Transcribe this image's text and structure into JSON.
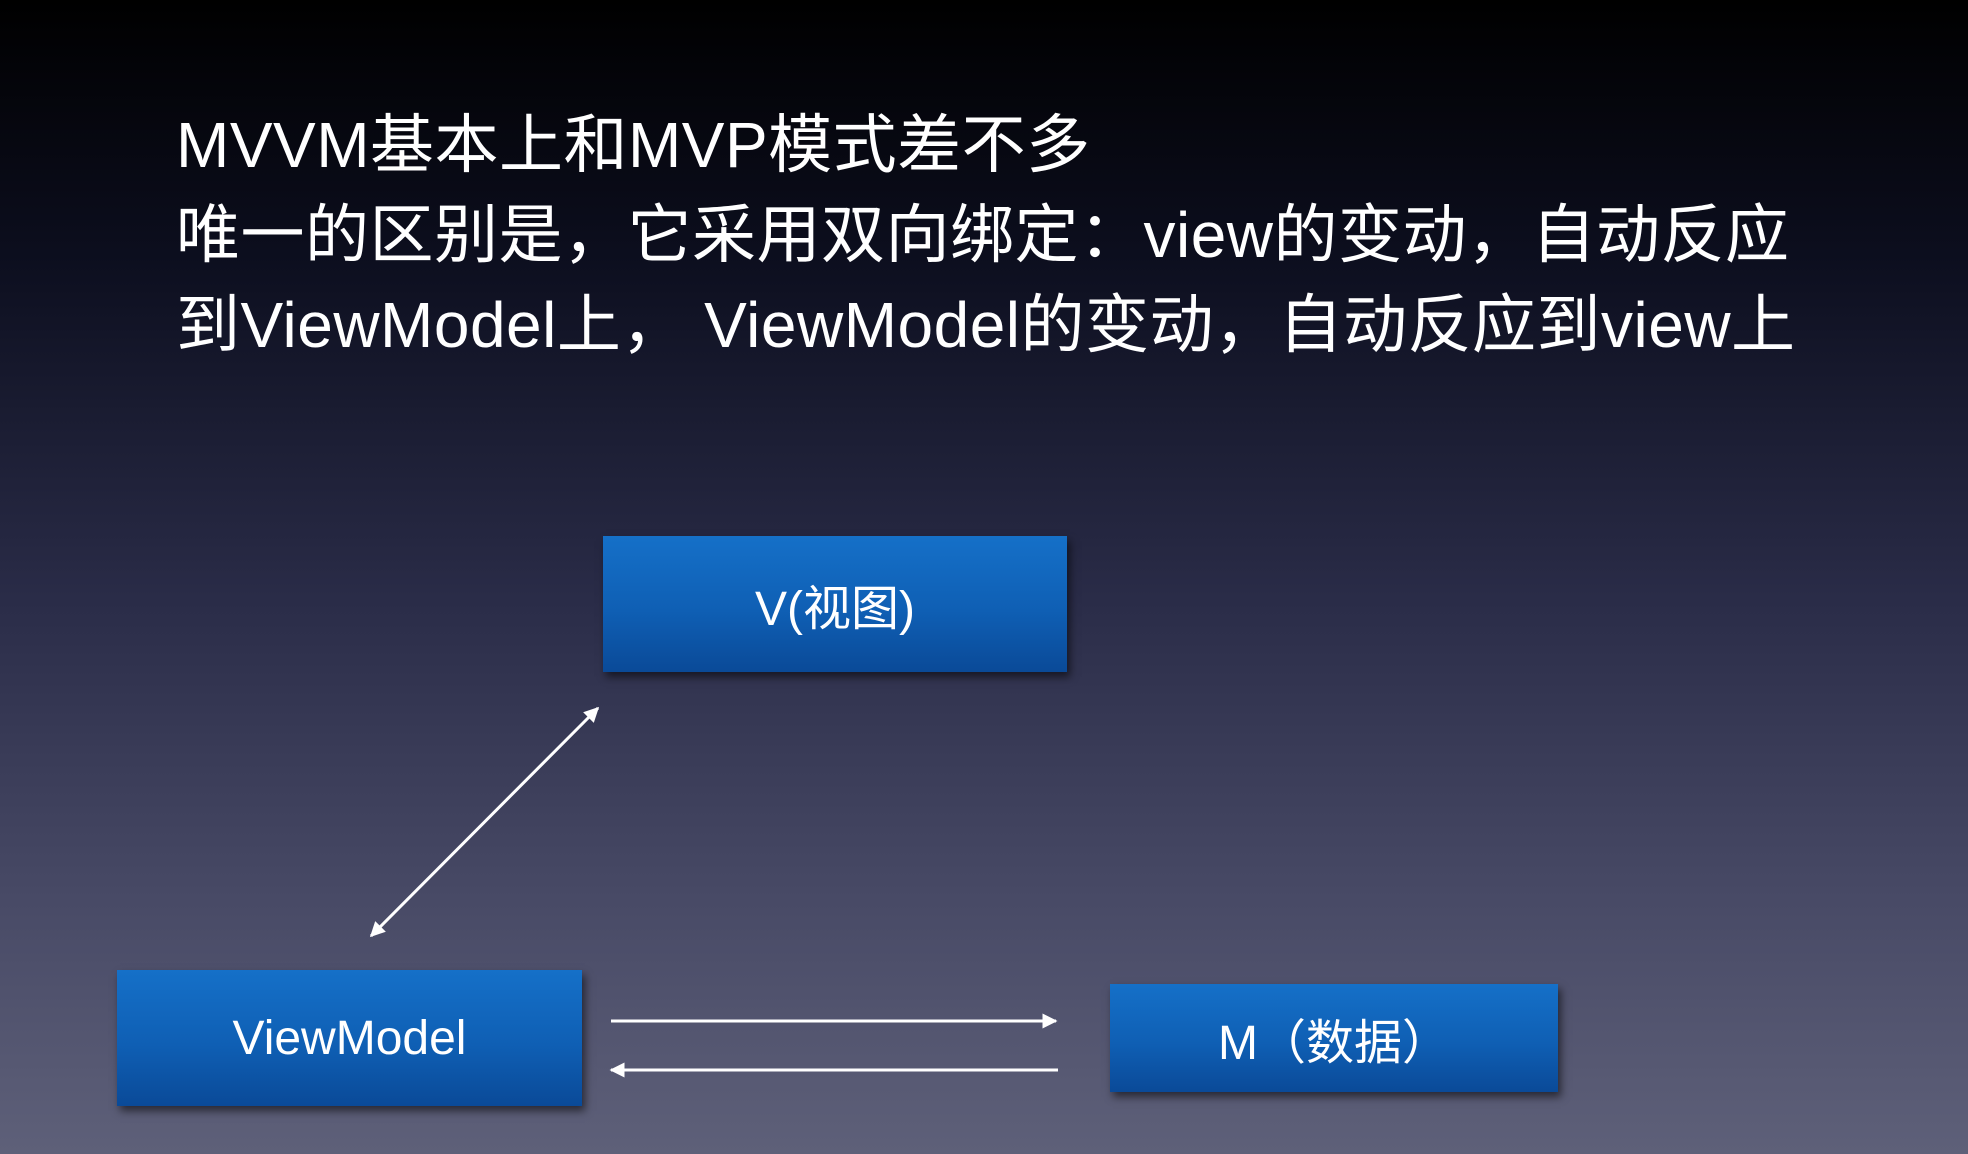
{
  "heading": {
    "lines": [
      "MVVM基本上和MVP模式差不多",
      "唯一的区别是，它采用双向绑定：view的变动，自动反应",
      "到ViewModel上， ViewModel的变动，自动反应到view上"
    ]
  },
  "diagram": {
    "nodes": {
      "view": "V(视图)",
      "viewmodel": "ViewModel",
      "model": "M（数据）"
    },
    "edges": [
      {
        "from": "view",
        "to": "viewmodel",
        "direction": "both"
      },
      {
        "from": "viewmodel",
        "to": "model",
        "direction": "forward"
      },
      {
        "from": "model",
        "to": "viewmodel",
        "direction": "forward"
      }
    ],
    "box_color": "#1268c0",
    "arrow_color": "#ffffff"
  }
}
